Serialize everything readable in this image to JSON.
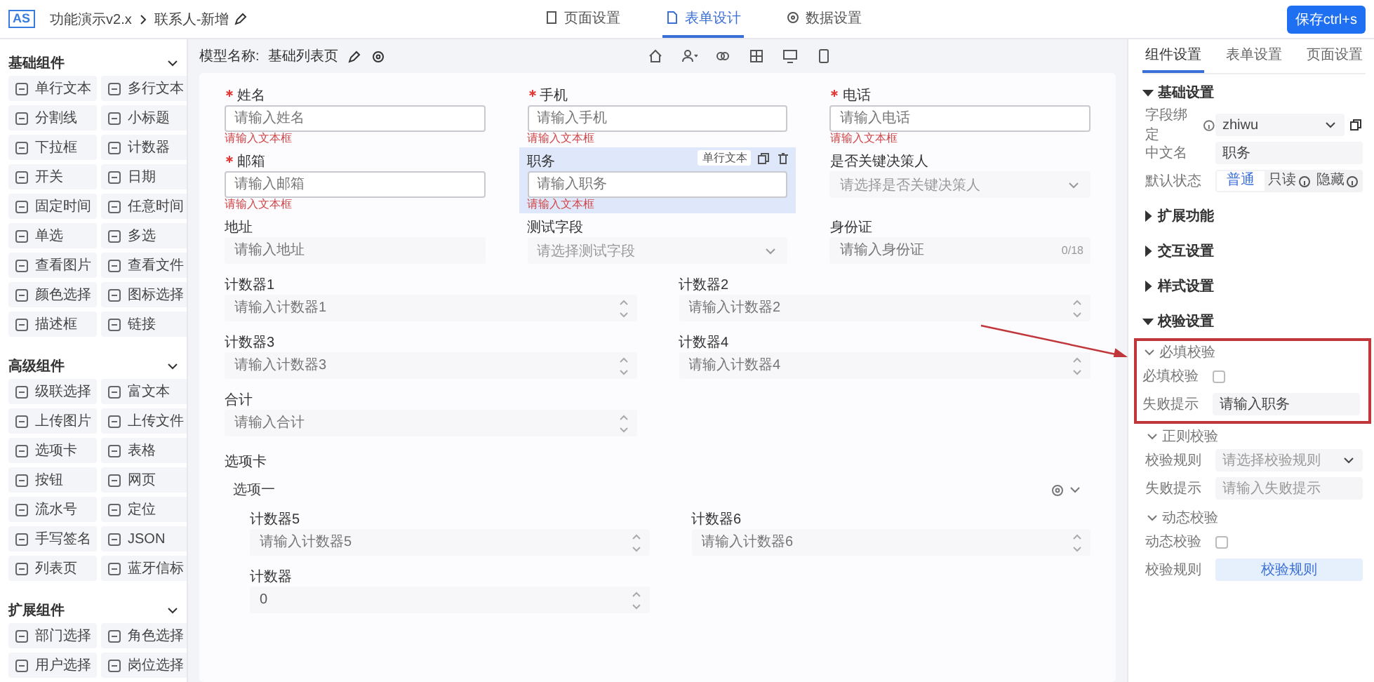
{
  "header": {
    "logo": "AS",
    "crumbs": [
      "功能演示v2.x",
      "联系人-新增"
    ],
    "tabs": [
      {
        "label": "页面设置",
        "selected": false
      },
      {
        "label": "表单设计",
        "selected": true
      },
      {
        "label": "数据设置",
        "selected": false
      }
    ],
    "save_button": "保存ctrl+s"
  },
  "sidebar": {
    "groups": [
      {
        "title": "基础组件",
        "expanded": true,
        "items": [
          "单行文本",
          "多行文本",
          "分割线",
          "小标题",
          "下拉框",
          "计数器",
          "开关",
          "日期",
          "固定时间",
          "任意时间",
          "单选",
          "多选",
          "查看图片",
          "查看文件",
          "颜色选择",
          "图标选择",
          "描述框",
          "链接"
        ]
      },
      {
        "title": "高级组件",
        "expanded": true,
        "items": [
          "级联选择",
          "富文本",
          "上传图片",
          "上传文件",
          "选项卡",
          "表格",
          "按钮",
          "网页",
          "流水号",
          "定位",
          "手写签名",
          "JSON",
          "列表页",
          "蓝牙信标"
        ]
      },
      {
        "title": "扩展组件",
        "expanded": true,
        "items": [
          "部门选择",
          "角色选择",
          "用户选择",
          "岗位选择"
        ]
      }
    ]
  },
  "toolbar": {
    "model_label": "模型名称:",
    "model_name": "基础列表页"
  },
  "form": {
    "rows": [
      {
        "fields": [
          {
            "kind": "input",
            "label": "姓名",
            "required": true,
            "placeholder": "请输入姓名",
            "error": "请输入文本框",
            "selected": false
          },
          {
            "kind": "input",
            "label": "手机",
            "required": true,
            "placeholder": "请输入手机",
            "error": "请输入文本框",
            "selected": false
          },
          {
            "kind": "input",
            "label": "电话",
            "required": true,
            "placeholder": "请输入电话",
            "error": "请输入文本框",
            "selected": false
          }
        ]
      },
      {
        "fields": [
          {
            "kind": "input",
            "label": "邮箱",
            "required": true,
            "placeholder": "请输入邮箱",
            "error": "请输入文本框",
            "selected": false
          },
          {
            "kind": "input",
            "label": "职务",
            "required": false,
            "placeholder": "请输入职务",
            "error": "请输入文本框",
            "selected": true,
            "type_tag": "单行文本"
          },
          {
            "kind": "select",
            "label": "是否关键决策人",
            "required": false,
            "placeholder": "请选择是否关键决策人",
            "selected": false
          }
        ]
      },
      {
        "fields": [
          {
            "kind": "input",
            "label": "地址",
            "required": false,
            "placeholder": "请输入地址",
            "selected": false
          },
          {
            "kind": "select",
            "label": "测试字段",
            "required": false,
            "placeholder": "请选择测试字段",
            "selected": false
          },
          {
            "kind": "input",
            "label": "身份证",
            "required": false,
            "placeholder": "请输入身份证",
            "counter": "0/18",
            "selected": false
          }
        ]
      },
      {
        "fields": [
          {
            "kind": "number",
            "label": "计数器1",
            "required": false,
            "placeholder": "请输入计数器1",
            "selected": false
          },
          {
            "kind": "number",
            "label": "计数器2",
            "required": false,
            "placeholder": "请输入计数器2",
            "selected": false
          }
        ]
      },
      {
        "fields": [
          {
            "kind": "number",
            "label": "计数器3",
            "required": false,
            "placeholder": "请输入计数器3",
            "selected": false
          },
          {
            "kind": "number",
            "label": "计数器4",
            "required": false,
            "placeholder": "请输入计数器4",
            "selected": false
          }
        ]
      },
      {
        "fields": [
          {
            "kind": "number",
            "label": "合计",
            "required": false,
            "placeholder": "请输入合计",
            "selected": false
          }
        ]
      }
    ],
    "tab_section": {
      "label": "选项卡",
      "tab": "选项一",
      "rows": [
        {
          "fields": [
            {
              "kind": "number",
              "label": "计数器5",
              "required": false,
              "placeholder": "请输入计数器5",
              "selected": false
            },
            {
              "kind": "number",
              "label": "计数器6",
              "required": false,
              "placeholder": "请输入计数器6",
              "selected": false
            }
          ]
        },
        {
          "fields": [
            {
              "kind": "number",
              "label": "计数器",
              "required": false,
              "value": "0",
              "selected": false
            }
          ]
        }
      ]
    }
  },
  "panel": {
    "tabs": [
      {
        "label": "组件设置",
        "selected": true
      },
      {
        "label": "表单设置",
        "selected": false
      },
      {
        "label": "页面设置",
        "selected": false
      }
    ],
    "sections": [
      {
        "title": "基础设置",
        "expanded": true,
        "groups": [
          {
            "fields": [
              {
                "kind": "select",
                "label": "字段绑定",
                "info": true,
                "value": "zhiwu"
              },
              {
                "kind": "text",
                "label": "中文名",
                "value": "职务"
              },
              {
                "kind": "radio",
                "label": "默认状态",
                "options": [
                  {
                    "label": "普通",
                    "selected": true,
                    "info": false
                  },
                  {
                    "label": "只读",
                    "selected": false,
                    "info": true
                  },
                  {
                    "label": "隐藏",
                    "selected": false,
                    "info": true
                  }
                ]
              }
            ]
          }
        ]
      },
      {
        "title": "扩展功能",
        "expanded": false
      },
      {
        "title": "交互设置",
        "expanded": false
      },
      {
        "title": "样式设置",
        "expanded": false
      },
      {
        "title": "校验设置",
        "expanded": true,
        "groups": [
          {
            "title": "必填校验",
            "highlighted": true,
            "fields": [
              {
                "kind": "checkbox",
                "label": "必填校验",
                "checked": false
              },
              {
                "kind": "text",
                "label": "失败提示",
                "value": "请输入职务"
              }
            ]
          },
          {
            "title": "正则校验",
            "highlighted": false,
            "fields": [
              {
                "kind": "select",
                "label": "校验规则",
                "placeholder": "请选择校验规则"
              },
              {
                "kind": "text",
                "label": "失败提示",
                "placeholder": "请输入失败提示"
              }
            ]
          },
          {
            "title": "动态校验",
            "highlighted": false,
            "fields": [
              {
                "kind": "checkbox",
                "label": "动态校验",
                "checked": false
              },
              {
                "kind": "button",
                "label": "校验规则",
                "value": "校验规则"
              }
            ]
          }
        ]
      }
    ]
  }
}
